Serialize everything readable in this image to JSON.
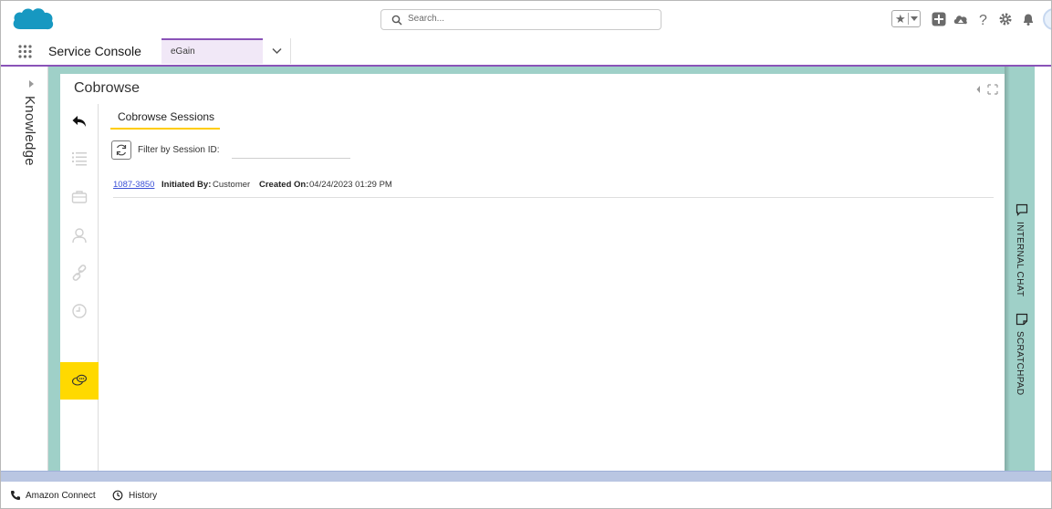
{
  "header": {
    "search_placeholder": "Search...",
    "icons": [
      "salesforce-cloud-logo",
      "search-icon",
      "favorites-star-icon",
      "add-icon",
      "trailhead-icon",
      "help-icon",
      "gear-icon",
      "bell-icon",
      "avatar"
    ]
  },
  "nav": {
    "app_name": "Service Console",
    "tabs": [
      {
        "label": "eGain"
      }
    ]
  },
  "left_panel": {
    "label": "Knowledge"
  },
  "main": {
    "title": "Cobrowse",
    "sub_tab": "Cobrowse Sessions",
    "filter_label": "Filter by Session ID:",
    "filter_value": "",
    "sessions": [
      {
        "id": "1087-3850",
        "initiated_by_label": "Initiated By:",
        "initiated_by": "Customer",
        "created_on_label": "Created On:",
        "created_on": "04/24/2023 01:29 PM"
      }
    ],
    "rail_icons": [
      "back-arrow-icon",
      "list-icon",
      "briefcase-icon",
      "contact-icon",
      "link-icon",
      "history-clock-icon",
      "cobrowse-chat-icon"
    ]
  },
  "right_panel": {
    "internal_chat": "INTERNAL CHAT",
    "scratchpad": "SCRATCHPAD"
  },
  "footer": {
    "items": [
      {
        "label": "Amazon Connect",
        "icon": "phone-icon"
      },
      {
        "label": "History",
        "icon": "history-icon"
      }
    ]
  },
  "colors": {
    "accent_purple": "#8a53b8",
    "workspace_teal": "#9fd0c8",
    "active_yellow": "#ffd900",
    "tab_underline": "#ffcc00",
    "salesforce_blue": "#1798c1",
    "link_blue": "#3a4fd6",
    "footer_stripe": "#b9c6e2"
  }
}
